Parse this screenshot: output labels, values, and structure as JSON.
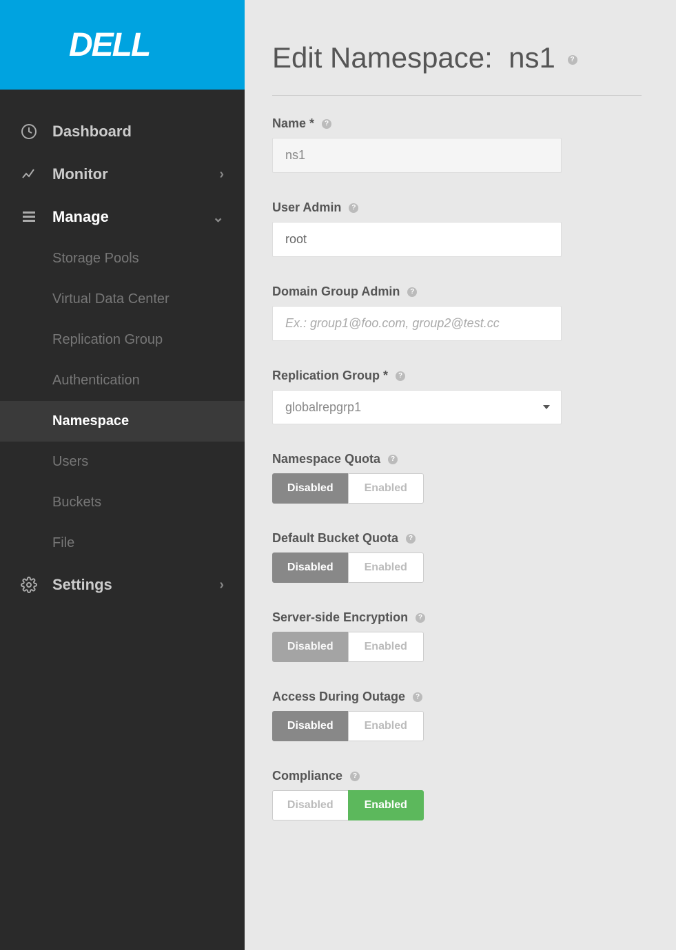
{
  "brand": "DELL",
  "sidebar": {
    "items": [
      {
        "icon": "clock-icon",
        "label": "Dashboard",
        "hasChevron": false
      },
      {
        "icon": "chart-icon",
        "label": "Monitor",
        "hasChevron": true,
        "chevron": "right"
      },
      {
        "icon": "grid-icon",
        "label": "Manage",
        "hasChevron": true,
        "chevron": "down",
        "expanded": true
      },
      {
        "icon": "gear-icon",
        "label": "Settings",
        "hasChevron": true,
        "chevron": "right"
      }
    ],
    "manageSubmenu": [
      {
        "label": "Storage Pools",
        "active": false
      },
      {
        "label": "Virtual Data Center",
        "active": false
      },
      {
        "label": "Replication Group",
        "active": false
      },
      {
        "label": "Authentication",
        "active": false
      },
      {
        "label": "Namespace",
        "active": true
      },
      {
        "label": "Users",
        "active": false
      },
      {
        "label": "Buckets",
        "active": false
      },
      {
        "label": "File",
        "active": false
      }
    ]
  },
  "page": {
    "titlePrefix": "Edit Namespace:",
    "titleValue": "ns1"
  },
  "form": {
    "name": {
      "label": "Name *",
      "value": "ns1"
    },
    "userAdmin": {
      "label": "User Admin",
      "value": "root"
    },
    "domainGroupAdmin": {
      "label": "Domain Group Admin",
      "placeholder": "Ex.: group1@foo.com, group2@test.cc"
    },
    "replicationGroup": {
      "label": "Replication Group *",
      "selected": "globalrepgrp1"
    },
    "namespaceQuota": {
      "label": "Namespace Quota",
      "disabled": "Disabled",
      "enabled": "Enabled",
      "selected": "disabled"
    },
    "bucketQuota": {
      "label": "Default Bucket Quota",
      "disabled": "Disabled",
      "enabled": "Enabled",
      "selected": "disabled"
    },
    "encryption": {
      "label": "Server-side Encryption",
      "disabled": "Disabled",
      "enabled": "Enabled",
      "selected": "disabled"
    },
    "outage": {
      "label": "Access During Outage",
      "disabled": "Disabled",
      "enabled": "Enabled",
      "selected": "disabled"
    },
    "compliance": {
      "label": "Compliance",
      "disabled": "Disabled",
      "enabled": "Enabled",
      "selected": "enabled"
    }
  }
}
